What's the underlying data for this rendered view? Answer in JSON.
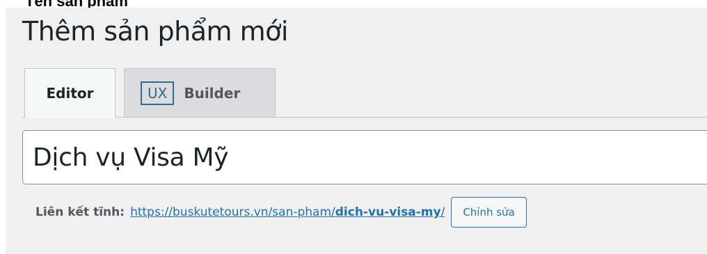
{
  "top_label": "Tên sản phẩm",
  "page_title": "Thêm sản phẩm mới",
  "tabs": {
    "editor_label": "Editor",
    "ux_badge": "UX",
    "builder_label": "Builder"
  },
  "title_field": {
    "value": "Dịch vụ Visa Mỹ"
  },
  "permalink": {
    "label": "Liên kết tĩnh:",
    "base_url": "https://buskutetours.vn/san-pham/",
    "slug": "dich-vu-visa-my",
    "trailing": "/",
    "edit_label": "Chỉnh sửa"
  },
  "colors": {
    "link": "#2271b1",
    "panel_background": "#f0f0f1",
    "ux_badge": "#2c6b8a"
  }
}
